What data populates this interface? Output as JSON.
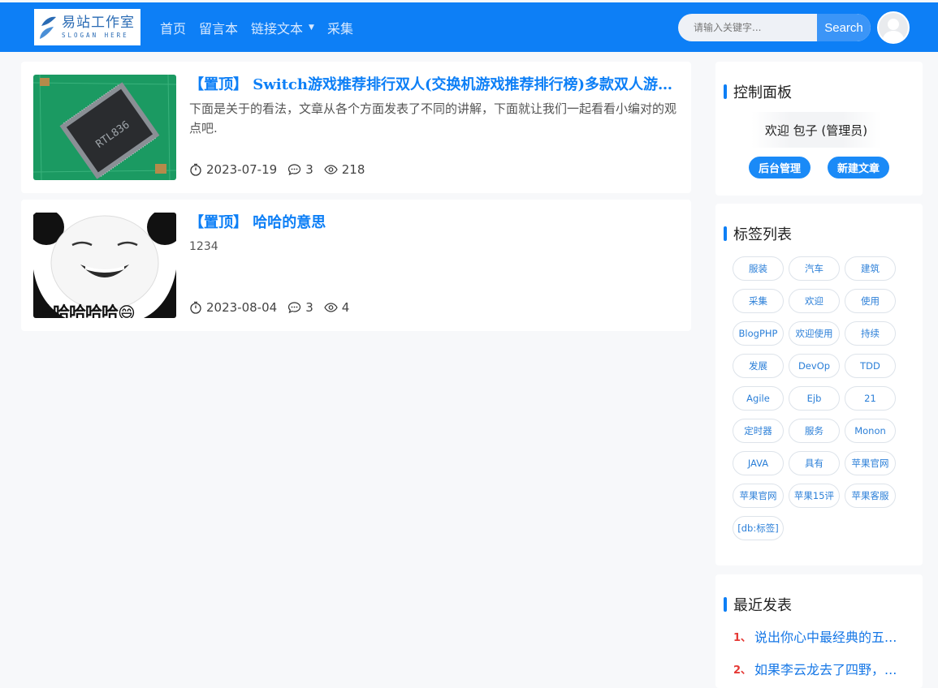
{
  "header": {
    "logo": {
      "title": "易站工作室",
      "slogan": "SLOGAN HERE"
    },
    "nav": [
      {
        "label": "首页"
      },
      {
        "label": "留言本"
      },
      {
        "label": "链接文本",
        "dropdown": true
      },
      {
        "label": "采集"
      }
    ],
    "search": {
      "placeholder": "请输入关键字...",
      "button_label": "Search"
    }
  },
  "posts": [
    {
      "title": "【置顶】 Switch游戏推荐排行双人(交换机游戏推荐排行榜)多款双人游戏推荐",
      "excerpt": "下面是关于的看法，文章从各个方面发表了不同的讲解，下面就让我们一起看看小编对的观点吧.",
      "date": "2023-07-19",
      "comments": "3",
      "views": "218",
      "thumb": "circuit-board-chip-image"
    },
    {
      "title": "【置顶】 哈哈的意思",
      "excerpt": "1234",
      "date": "2023-08-04",
      "comments": "3",
      "views": "4",
      "thumb": "panda-meme-image",
      "thumb_caption": "哈哈哈哈哈😄"
    }
  ],
  "sidebar": {
    "control_panel": {
      "title": "控制面板",
      "welcome": "欢迎 包子 (管理员)",
      "admin_button": "后台管理",
      "new_post_button": "新建文章"
    },
    "tags": {
      "title": "标签列表",
      "items": [
        "服装",
        "汽车",
        "建筑",
        "采集",
        "欢迎",
        "使用",
        "BlogPHP",
        "欢迎使用",
        "持续",
        "发展",
        "DevOp",
        "TDD",
        "Agile",
        "Ejb",
        "21",
        "定时器",
        "服务",
        "Monon",
        "JAVA",
        "具有",
        "苹果官网",
        "苹果官网",
        "苹果15评",
        "苹果客服",
        "[db:标签]"
      ]
    },
    "recent": {
      "title": "最近发表",
      "items": [
        {
          "num": "1、",
          "text": "说出你心中最经典的五..."
        },
        {
          "num": "2、",
          "text": "如果李云龙去了四野，..."
        }
      ]
    }
  },
  "colors": {
    "brand": "#0d7ff6",
    "accent_red": "#e53935"
  }
}
